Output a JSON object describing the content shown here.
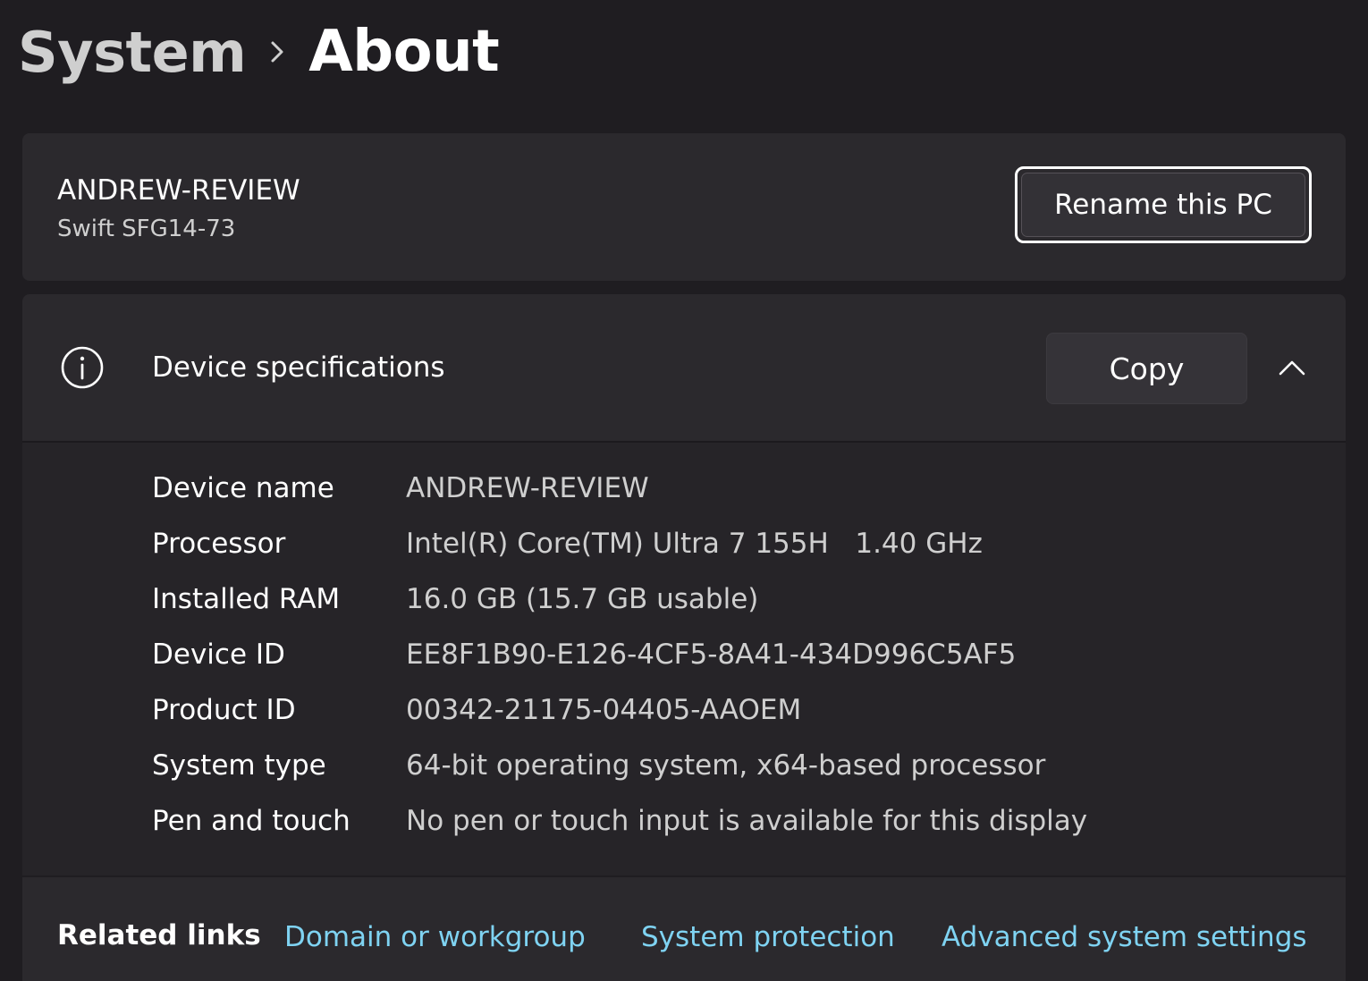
{
  "breadcrumb": {
    "parent": "System",
    "current": "About"
  },
  "device_header": {
    "name": "ANDREW-REVIEW",
    "model": "Swift SFG14-73",
    "rename_label": "Rename this PC"
  },
  "specs": {
    "title": "Device specifications",
    "copy_label": "Copy",
    "rows": [
      {
        "label": "Device name",
        "value": "ANDREW-REVIEW"
      },
      {
        "label": "Processor",
        "value": "Intel(R) Core(TM) Ultra 7 155H   1.40 GHz"
      },
      {
        "label": "Installed RAM",
        "value": "16.0 GB (15.7 GB usable)"
      },
      {
        "label": "Device ID",
        "value": "EE8F1B90-E126-4CF5-8A41-434D996C5AF5"
      },
      {
        "label": "Product ID",
        "value": "00342-21175-04405-AAOEM"
      },
      {
        "label": "System type",
        "value": "64-bit operating system, x64-based processor"
      },
      {
        "label": "Pen and touch",
        "value": "No pen or touch input is available for this display"
      }
    ]
  },
  "related_links": {
    "title": "Related links",
    "links": [
      {
        "label": "Domain or workgroup"
      },
      {
        "label": "System protection"
      },
      {
        "label": "Advanced system settings"
      }
    ]
  },
  "colors": {
    "link": "#7fd3f2",
    "background": "#1f1d21",
    "card": "#2b292d"
  },
  "icons": {
    "breadcrumb_separator": "chevron-right-icon",
    "specs": "info-icon",
    "collapse": "chevron-up-icon"
  }
}
